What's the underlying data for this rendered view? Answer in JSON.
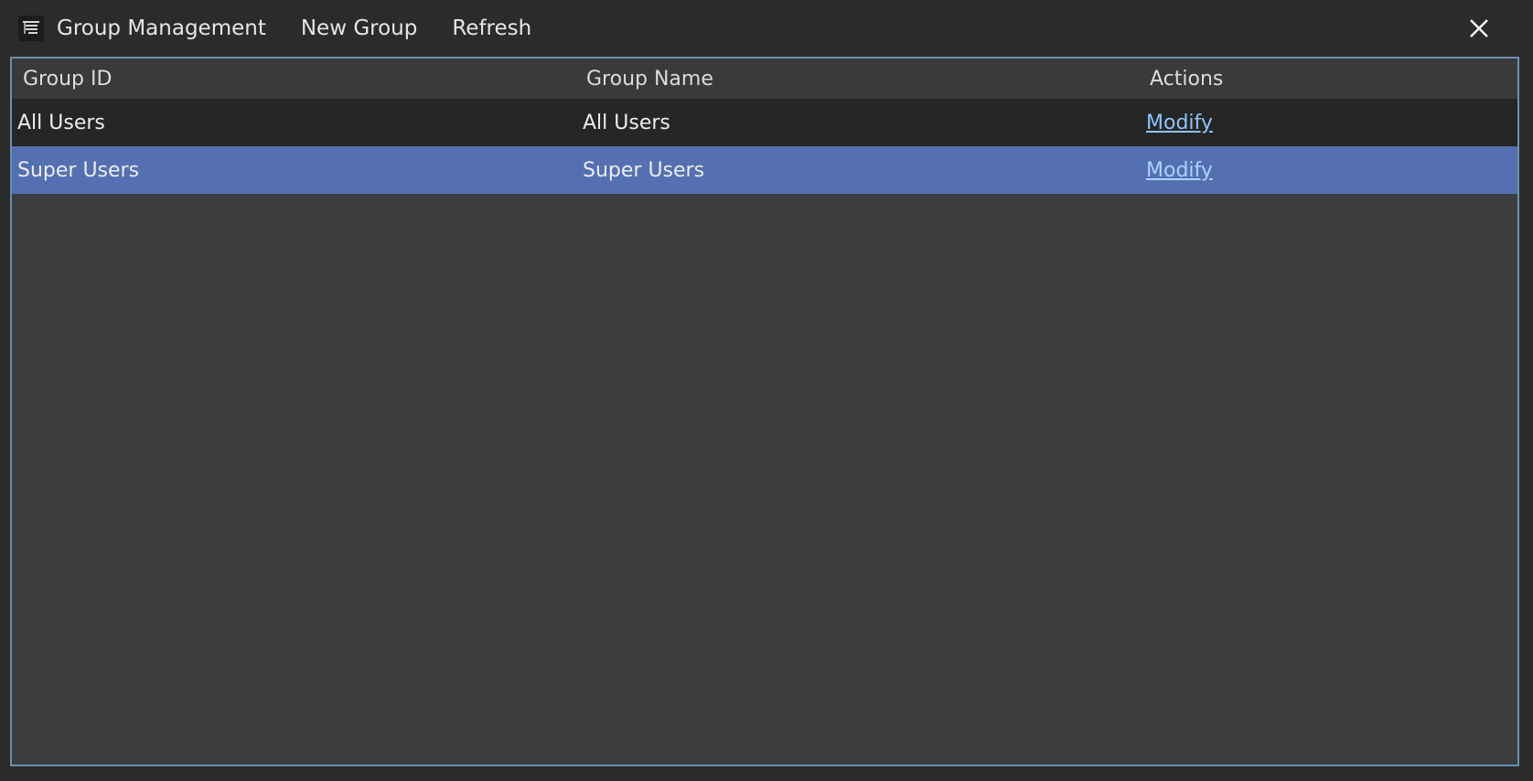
{
  "window": {
    "title": "Group Management",
    "app_icon": "group-management-icon",
    "close_icon": "close-icon"
  },
  "toolbar": {
    "new_group_label": "New Group",
    "refresh_label": "Refresh"
  },
  "table": {
    "columns": [
      "Group ID",
      "Group Name",
      "Actions"
    ],
    "rows": [
      {
        "group_id": "All Users",
        "group_name": "All Users",
        "action": "Modify",
        "selected": false
      },
      {
        "group_id": "Super Users",
        "group_name": "Super Users",
        "action": "Modify",
        "selected": true
      }
    ]
  },
  "colors": {
    "background": "#2b2b2b",
    "table_background": "#3c3d3f",
    "row_background": "#262626",
    "selected_row": "#5470b0",
    "link": "#8fc3ff",
    "frame_border": "#6b8fb0"
  }
}
